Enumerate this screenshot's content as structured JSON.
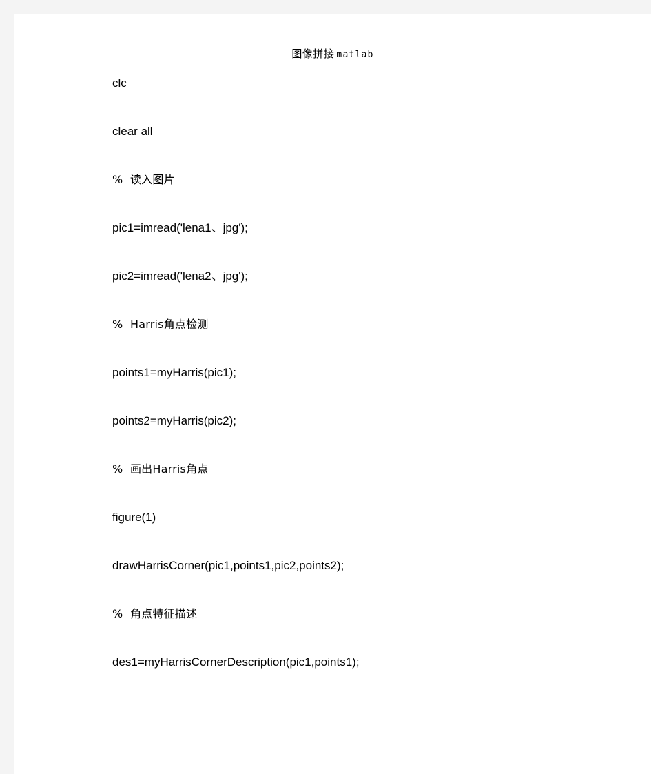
{
  "document": {
    "title_cjk": "图像拼接",
    "title_latin": "matlab",
    "lines": [
      {
        "text": "clc",
        "kind": "code"
      },
      {
        "text": "clear all",
        "kind": "code"
      },
      {
        "text": "%  读入图片",
        "kind": "comment"
      },
      {
        "text": "pic1=imread('lena1、jpg');",
        "kind": "code"
      },
      {
        "text": "pic2=imread('lena2、jpg');",
        "kind": "code"
      },
      {
        "text": "%  Harris角点检测",
        "kind": "comment"
      },
      {
        "text": "points1=myHarris(pic1);",
        "kind": "code"
      },
      {
        "text": "points2=myHarris(pic2);",
        "kind": "code"
      },
      {
        "text": "%  画出Harris角点",
        "kind": "comment"
      },
      {
        "text": "figure(1)",
        "kind": "code"
      },
      {
        "text": "drawHarrisCorner(pic1,points1,pic2,points2);",
        "kind": "code"
      },
      {
        "text": "%  角点特征描述",
        "kind": "comment"
      },
      {
        "text": "des1=myHarrisCornerDescription(pic1,points1);",
        "kind": "code"
      }
    ]
  },
  "colors": {
    "page_background": "#ffffff",
    "backdrop": "#f4f4f4",
    "text": "#000000"
  }
}
